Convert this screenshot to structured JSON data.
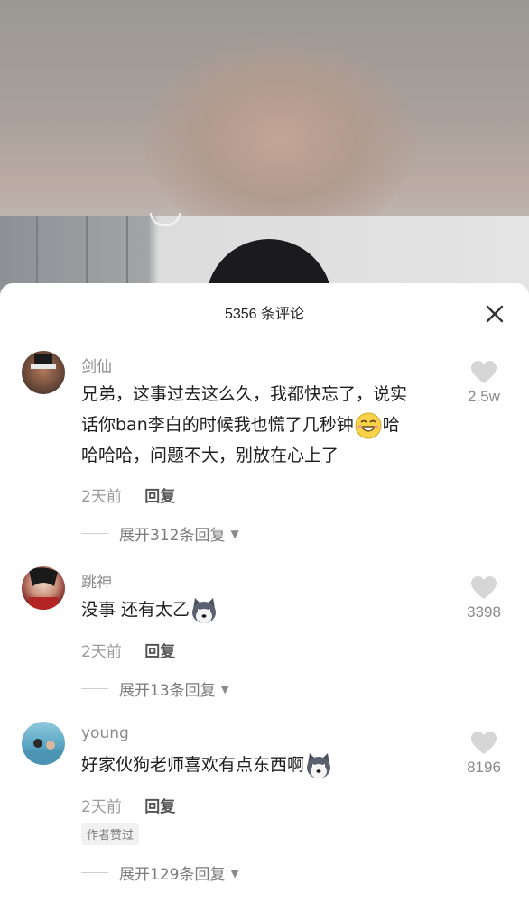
{
  "header": {
    "count_label": "5356 条评论"
  },
  "comments": [
    {
      "user": "剑仙",
      "text_1": "兄弟，这事过去这么久，我都快忘了，说实",
      "text_2a": "话你ban李白的时候我也慌了几秒钟",
      "text_2b": "哈",
      "text_3": "哈哈哈，问题不大，别放在心上了",
      "time": "2天前",
      "reply": "回复",
      "expand": "展开312条回复",
      "likes": "2.5w"
    },
    {
      "user": "跳神",
      "text": "没事 还有太乙",
      "time": "2天前",
      "reply": "回复",
      "expand": "展开13条回复",
      "likes": "3398"
    },
    {
      "user": "young",
      "text": "好家伙狗老师喜欢有点东西啊",
      "time": "2天前",
      "reply": "回复",
      "badge": "作者赞过",
      "expand": "展开129条回复",
      "likes": "8196"
    }
  ],
  "icons": {
    "close": "close-icon",
    "like": "heart-icon",
    "expand": "triangle-down-icon",
    "emoji_1": "grin-emoji",
    "emoji_2": "husky-emoji"
  },
  "colors": {
    "sheet_bg": "#ffffff",
    "muted_text": "#8a8a8a",
    "body_text": "#1e1e1e"
  }
}
